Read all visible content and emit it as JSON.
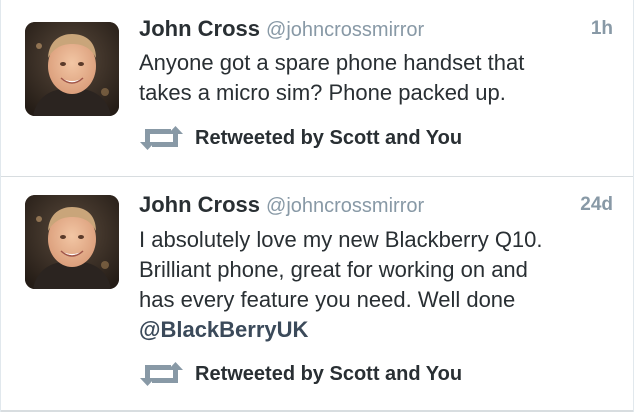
{
  "tweets": [
    {
      "fullname": "John Cross",
      "username": "@johncrossmirror",
      "time": "1h",
      "text_lines": [
        "Anyone got a spare phone handset that",
        "takes a micro sim? Phone packed up."
      ],
      "retweet_label": "Retweeted by Scott and You",
      "avatar_icon": "profile-photo"
    },
    {
      "fullname": "John Cross",
      "username": "@johncrossmirror",
      "time": "24d",
      "text_lines": [
        "I absolutely love my new Blackberry Q10.",
        "Brilliant phone, great for working on and",
        "has every feature you need. Well done"
      ],
      "mention": "@BlackBerryUK",
      "retweet_label": "Retweeted by Scott and You",
      "avatar_icon": "profile-photo"
    }
  ],
  "colors": {
    "text": "#292f33",
    "muted": "#8899a6",
    "mention": "#3b4a5a",
    "retweet_icon": "#8899a6",
    "divider": "#d8dde0"
  }
}
